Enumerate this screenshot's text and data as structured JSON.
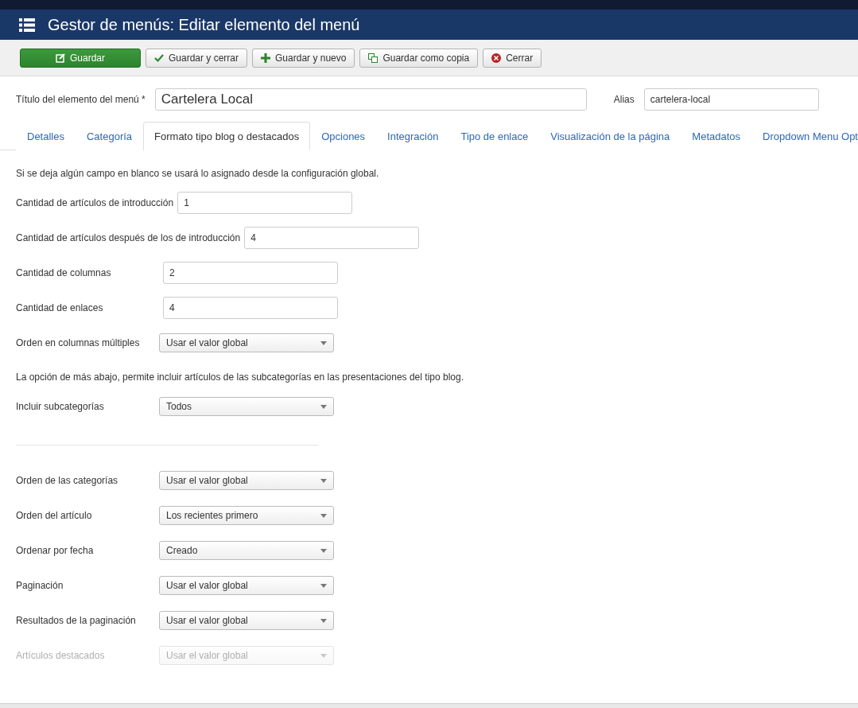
{
  "header": {
    "title": "Gestor de menús: Editar elemento del menú"
  },
  "toolbar": [
    {
      "label": "Guardar",
      "kind": "primary"
    },
    {
      "label": "Guardar y cerrar",
      "kind": "check"
    },
    {
      "label": "Guardar y nuevo",
      "kind": "plus"
    },
    {
      "label": "Guardar como copia",
      "kind": "copy"
    },
    {
      "label": "Cerrar",
      "kind": "close"
    }
  ],
  "title_field": {
    "label": "Título del elemento del menú *",
    "value": "Cartelera Local"
  },
  "alias_field": {
    "label": "Alias",
    "value": "cartelera-local"
  },
  "tabs": [
    {
      "label": "Detalles",
      "selected": false
    },
    {
      "label": "Categoría",
      "selected": false
    },
    {
      "label": "Formato tipo blog o destacados",
      "selected": true
    },
    {
      "label": "Opciones",
      "selected": false
    },
    {
      "label": "Integración",
      "selected": false
    },
    {
      "label": "Tipo de enlace",
      "selected": false
    },
    {
      "label": "Visualización de la página",
      "selected": false
    },
    {
      "label": "Metadatos",
      "selected": false
    },
    {
      "label": "Dropdown Menu Opt",
      "selected": false
    }
  ],
  "content": [
    {
      "kind": "note",
      "text": "Si se deja algún campo en blanco se usará lo asignado desde la configuración global."
    },
    {
      "kind": "text",
      "label": "Cantidad de artículos de introducción",
      "value": "1",
      "dimmed": false
    },
    {
      "kind": "text",
      "label": "Cantidad de artículos después de los de introducción",
      "value": "4",
      "dimmed": false
    },
    {
      "kind": "text",
      "label": "Cantidad de columnas",
      "value": "2",
      "dimmed": false
    },
    {
      "kind": "text",
      "label": "Cantidad de enlaces",
      "value": "4",
      "dimmed": false
    },
    {
      "kind": "select",
      "label": "Orden en columnas múltiples",
      "value": "Usar el valor global",
      "dimmed": false
    },
    {
      "kind": "note",
      "text": "La opción de más abajo, permite incluir artículos de las subcategorías en las presentaciones del tipo blog."
    },
    {
      "kind": "select",
      "label": "Incluir subcategorías",
      "value": "Todos",
      "dimmed": false
    },
    {
      "kind": "divider"
    },
    {
      "kind": "select",
      "label": "Orden de las categorías",
      "value": "Usar el valor global",
      "dimmed": false
    },
    {
      "kind": "select",
      "label": "Orden del artículo",
      "value": "Los recientes primero",
      "dimmed": false
    },
    {
      "kind": "select",
      "label": "Ordenar por fecha",
      "value": "Creado",
      "dimmed": false
    },
    {
      "kind": "select",
      "label": "Paginación",
      "value": "Usar el valor global",
      "dimmed": false
    },
    {
      "kind": "select",
      "label": "Resultados de la paginación",
      "value": "Usar el valor global",
      "dimmed": false
    },
    {
      "kind": "select",
      "label": "Artículos destacados",
      "value": "Usar el valor global",
      "dimmed": true
    }
  ]
}
